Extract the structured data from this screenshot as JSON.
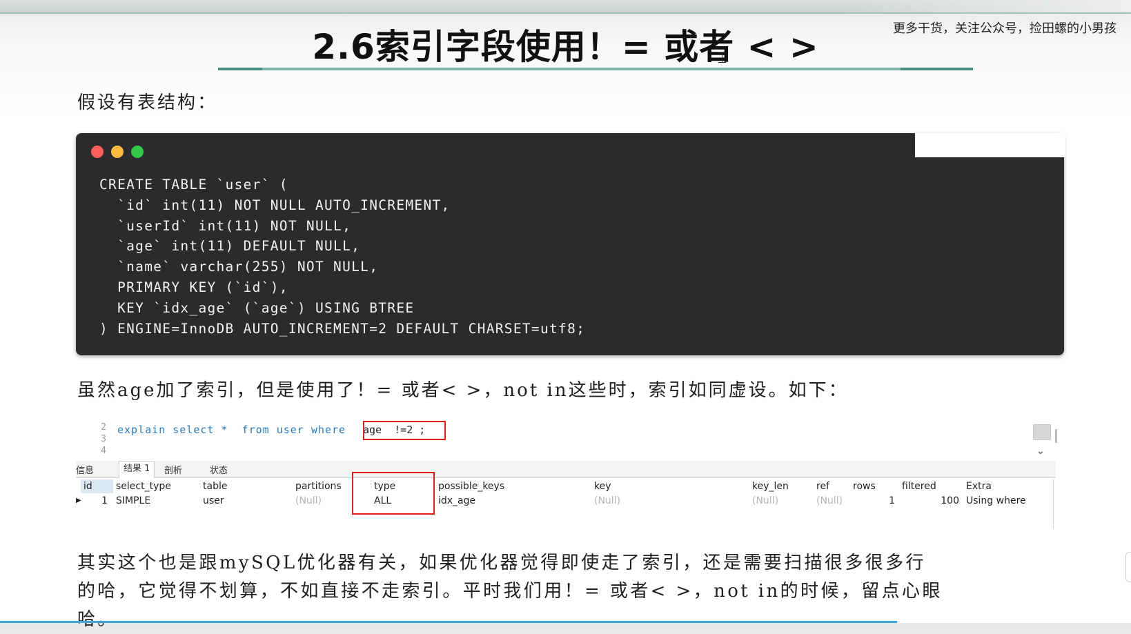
{
  "title": "2.6索引字段使用！= 或者 < >",
  "promo_text": "更多干货，关注公众号，捡田螺的小男孩",
  "intro_text": "假设有表结构：",
  "code": {
    "lines": [
      "CREATE TABLE `user` (",
      "  `id` int(11) NOT NULL AUTO_INCREMENT,",
      "  `userId` int(11) NOT NULL,",
      "  `age` int(11) DEFAULT NULL,",
      "  `name` varchar(255) NOT NULL,",
      "  PRIMARY KEY (`id`),",
      "  KEY `idx_age` (`age`) USING BTREE",
      ") ENGINE=InnoDB AUTO_INCREMENT=2 DEFAULT CHARSET=utf8;"
    ]
  },
  "explain_text": "虽然age加了索引，但是使用了！= 或者< >，not in这些时，索引如同虚设。如下：",
  "sql_editor": {
    "line_numbers": [
      "2",
      "3",
      "4"
    ],
    "query": "explain select *  from user where",
    "condition": "age  !=2 ;"
  },
  "result_tabs": [
    "信息",
    "结果 1",
    "剖析",
    "状态"
  ],
  "result_table": {
    "headers": [
      "id",
      "select_type",
      "table",
      "partitions",
      "type",
      "possible_keys",
      "key",
      "key_len",
      "ref",
      "rows",
      "filtered",
      "Extra"
    ],
    "row": [
      "1",
      "SIMPLE",
      "user",
      "(Null)",
      "ALL",
      "idx_age",
      "(Null)",
      "(Null)",
      "(Null)",
      "1",
      "100",
      "Using where"
    ]
  },
  "conclusion_text": {
    "line1": "其实这个也是跟mySQL优化器有关，如果优化器觉得即使走了索引，还是需要扫描很多很多行",
    "line2": "的哈，它觉得不划算，不如直接不走索引。平时我们用！= 或者< >，not in的时候，留点心眼",
    "line3": "哈。"
  },
  "colors": {
    "code_bg": "#2b2b2b",
    "highlight_box": "#e0211b",
    "title_rule": "#7fb3a8",
    "sql_keyword": "#2a7ab8"
  }
}
